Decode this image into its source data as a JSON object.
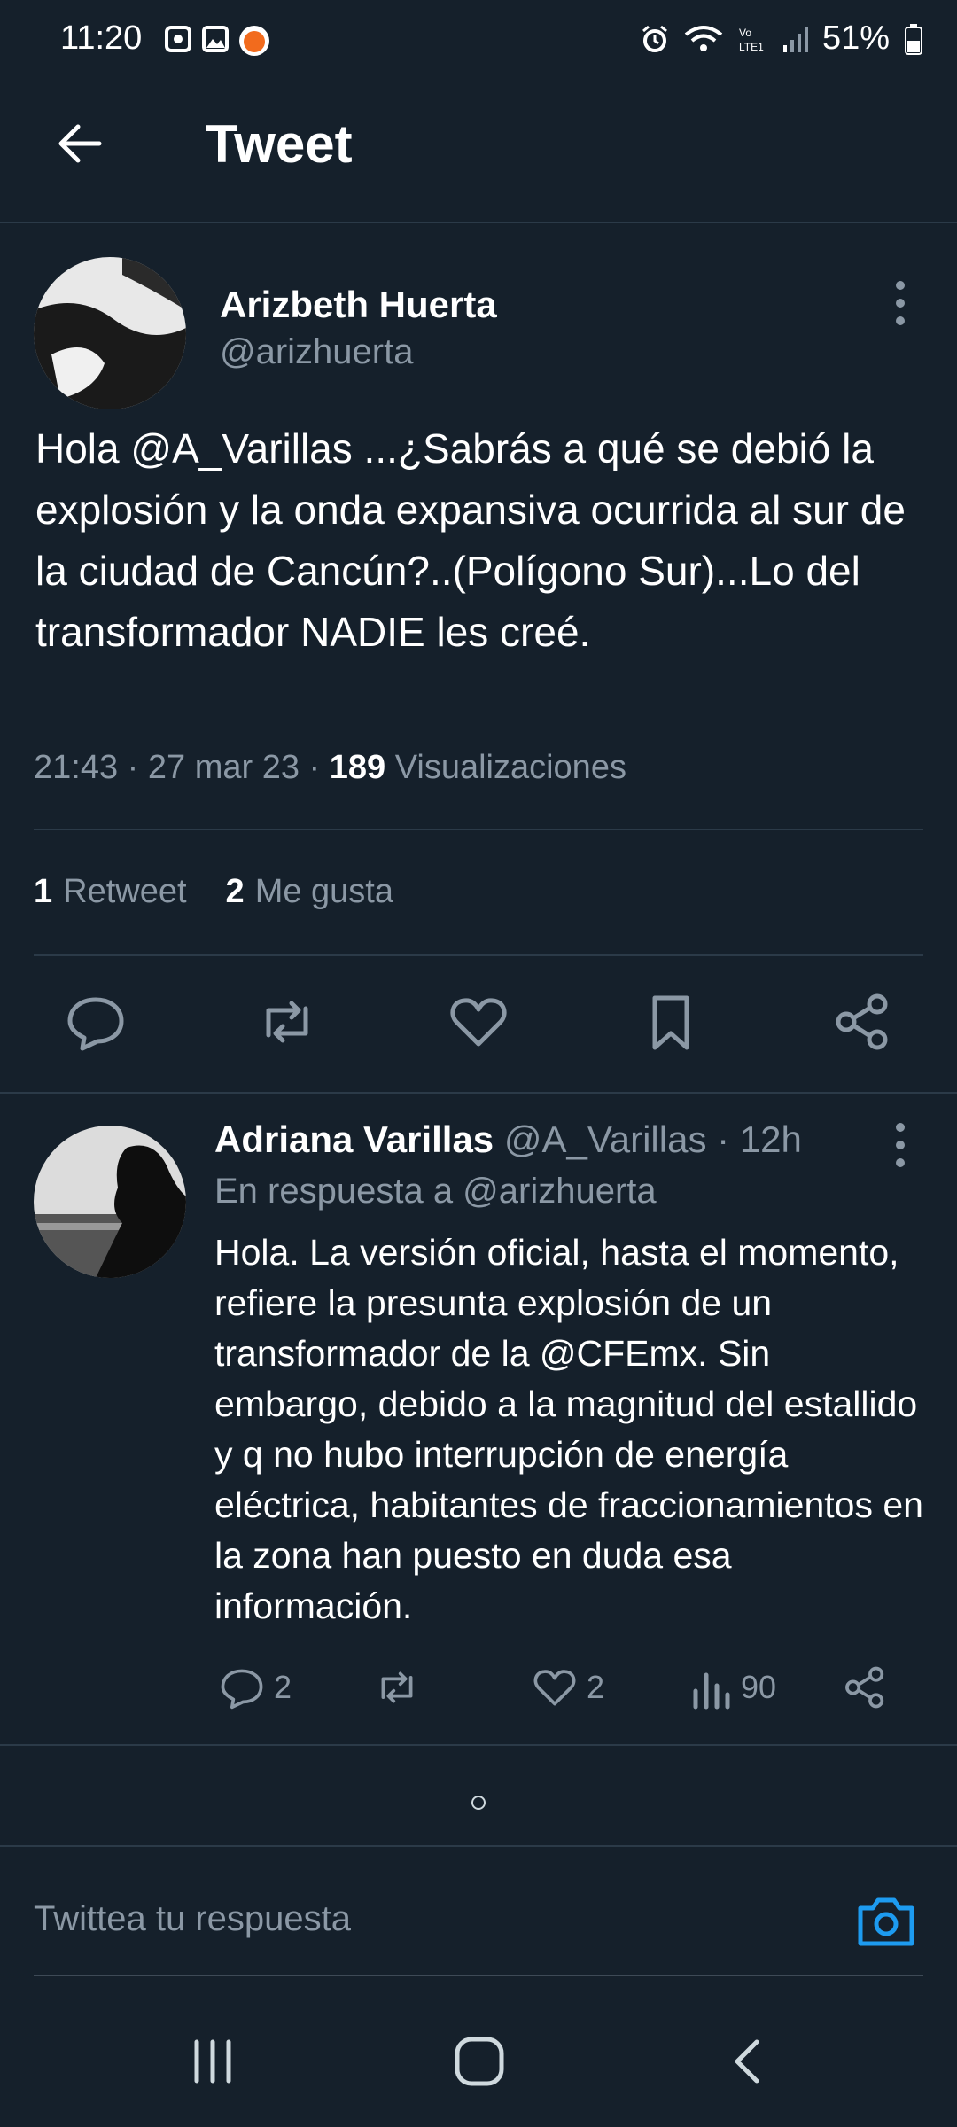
{
  "status_bar": {
    "time": "11:20",
    "battery": "51%"
  },
  "header": {
    "title": "Tweet"
  },
  "tweet": {
    "author_name": "Arizbeth Huerta",
    "author_handle": "@arizhuerta",
    "text": "Hola @A_Varillas ...¿Sabrás a qué se debió la explosión y la onda expansiva ocurrida al sur de la ciudad de Cancún?..(Polígono Sur)...Lo del transformador NADIE les creé.",
    "time": "21:43",
    "date": "27 mar 23",
    "views_count": "189",
    "views_label": "Visualizaciones",
    "retweets_count": "1",
    "retweets_label": "Retweet",
    "likes_count": "2",
    "likes_label": "Me gusta"
  },
  "reply": {
    "author_name": "Adriana Varillas",
    "author_handle": "@A_Varillas",
    "age": "12h",
    "in_reply_to": "En respuesta a @arizhuerta",
    "text": "Hola. La versión oficial, hasta el momento, refiere la presunta explosión de un transformador de la @CFEmx. Sin embargo, debido a la magnitud del estallido y q no hubo interrupción de energía eléctrica, habitantes de fraccionamientos en la zona han puesto en duda esa información.",
    "replies": "2",
    "likes": "2",
    "views": "90"
  },
  "compose": {
    "placeholder": "Twittea tu respuesta"
  },
  "colors": {
    "background": "#15202b",
    "accent": "#1d9bf0",
    "muted": "#8b98a5",
    "divider": "#2b3a48"
  }
}
